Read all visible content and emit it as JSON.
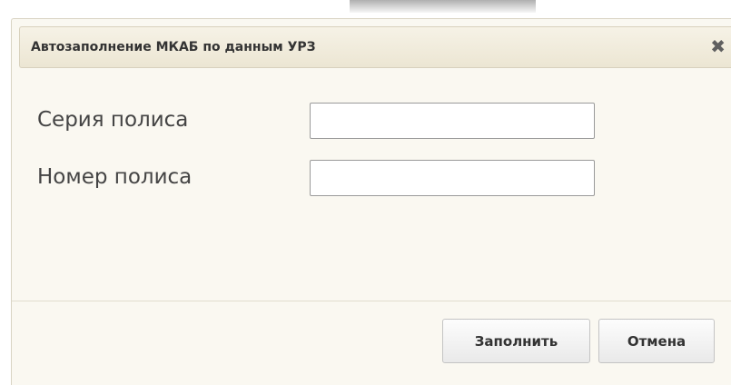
{
  "dialog": {
    "title": "Автозаполнение МКАБ по данным УРЗ",
    "close_icon": "close-icon",
    "close_glyph": "✖"
  },
  "form": {
    "fields": [
      {
        "label": "Серия полиса",
        "value": "",
        "placeholder": ""
      },
      {
        "label": "Номер полиса",
        "value": "",
        "placeholder": ""
      }
    ]
  },
  "footer": {
    "fill_label": "Заполнить",
    "cancel_label": "Отмена"
  }
}
